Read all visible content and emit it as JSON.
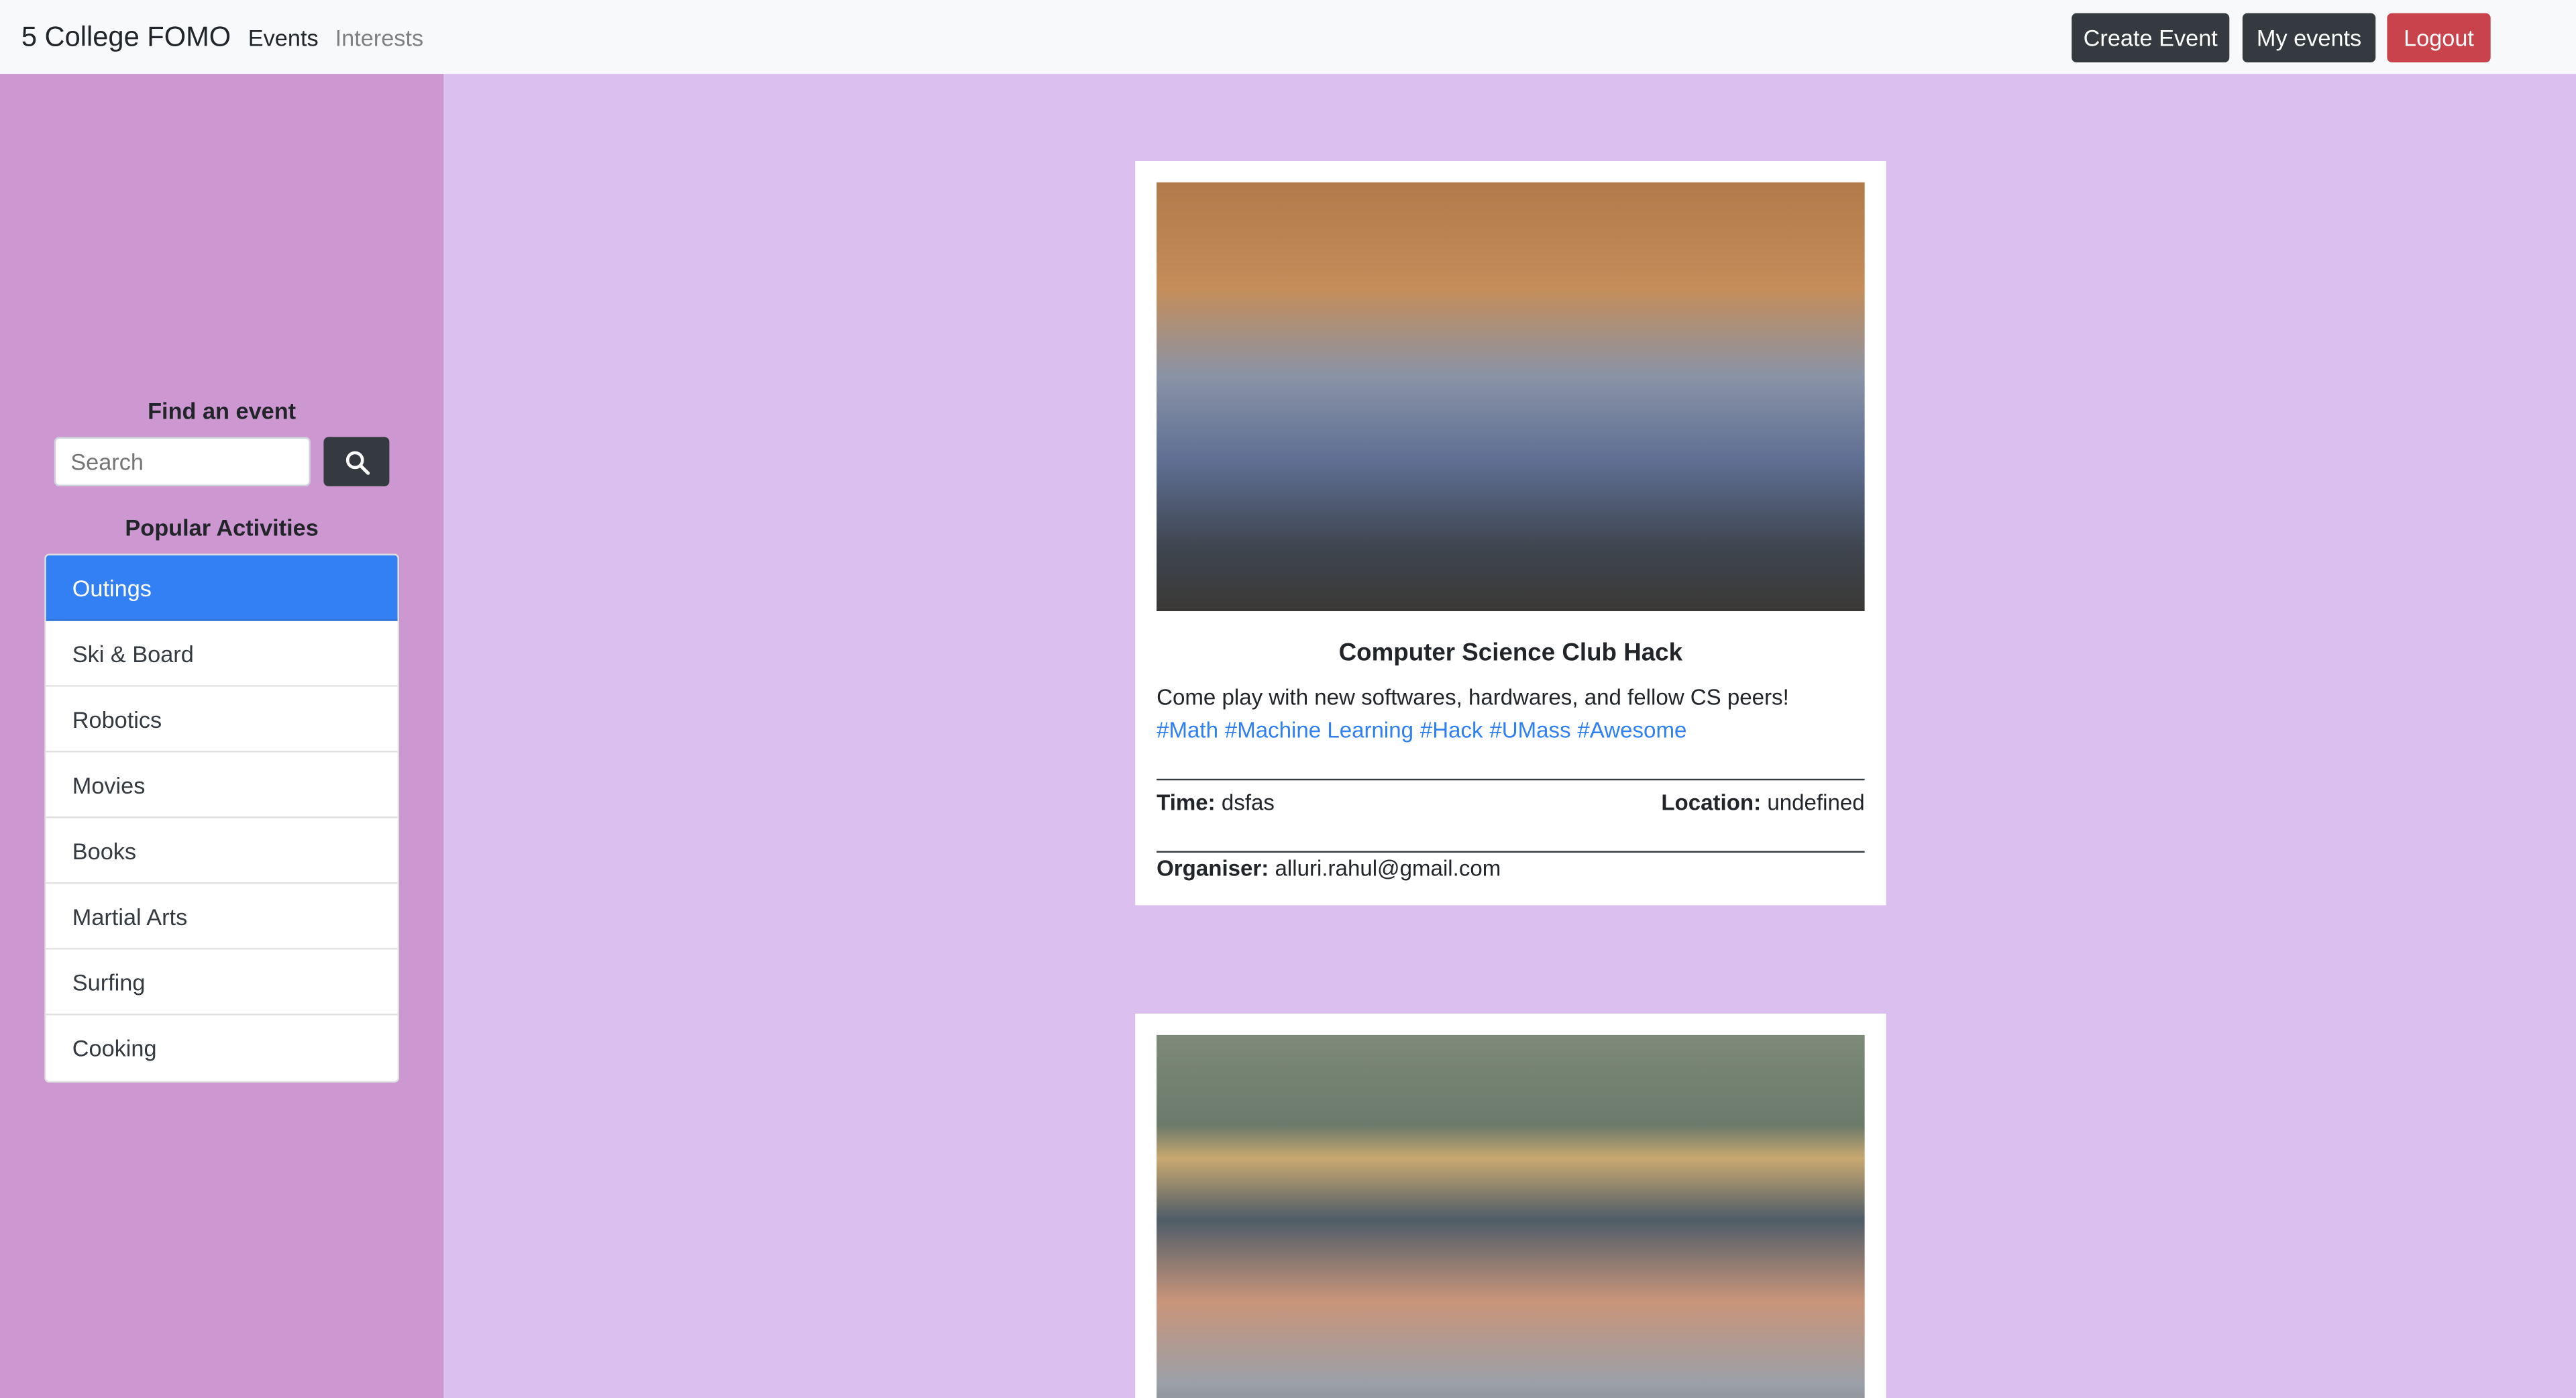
{
  "navbar": {
    "brand": "5 College FOMO",
    "links": [
      "Events",
      "Interests"
    ],
    "buttons": {
      "create": "Create Event",
      "my_events": "My events",
      "logout": "Logout"
    },
    "colors": {
      "dark": "#343a40",
      "danger": "#c9434c"
    }
  },
  "sidebar": {
    "find_title": "Find an event",
    "search_placeholder": "Search",
    "search_icon": "search-icon",
    "popular_title": "Popular Activities",
    "items": [
      "Outings",
      "Ski & Board",
      "Robotics",
      "Movies",
      "Books",
      "Martial Arts",
      "Surfing",
      "Cooking"
    ],
    "active": "Outings",
    "active_color": "#3380f5"
  },
  "events": [
    {
      "title": "Computer Science Club Hack",
      "description": "Come play with new softwares, hardwares, and fellow CS peers!",
      "tags": [
        "#Math",
        "#Machine Learning",
        "#Hack",
        "#UMass",
        "#Awesome"
      ],
      "time_label": "Time:",
      "time": "dsfas",
      "location_label": "Location:",
      "location": "undefined",
      "organiser_label": "Organiser:",
      "organiser": "alluri.rahul@gmail.com"
    }
  ]
}
